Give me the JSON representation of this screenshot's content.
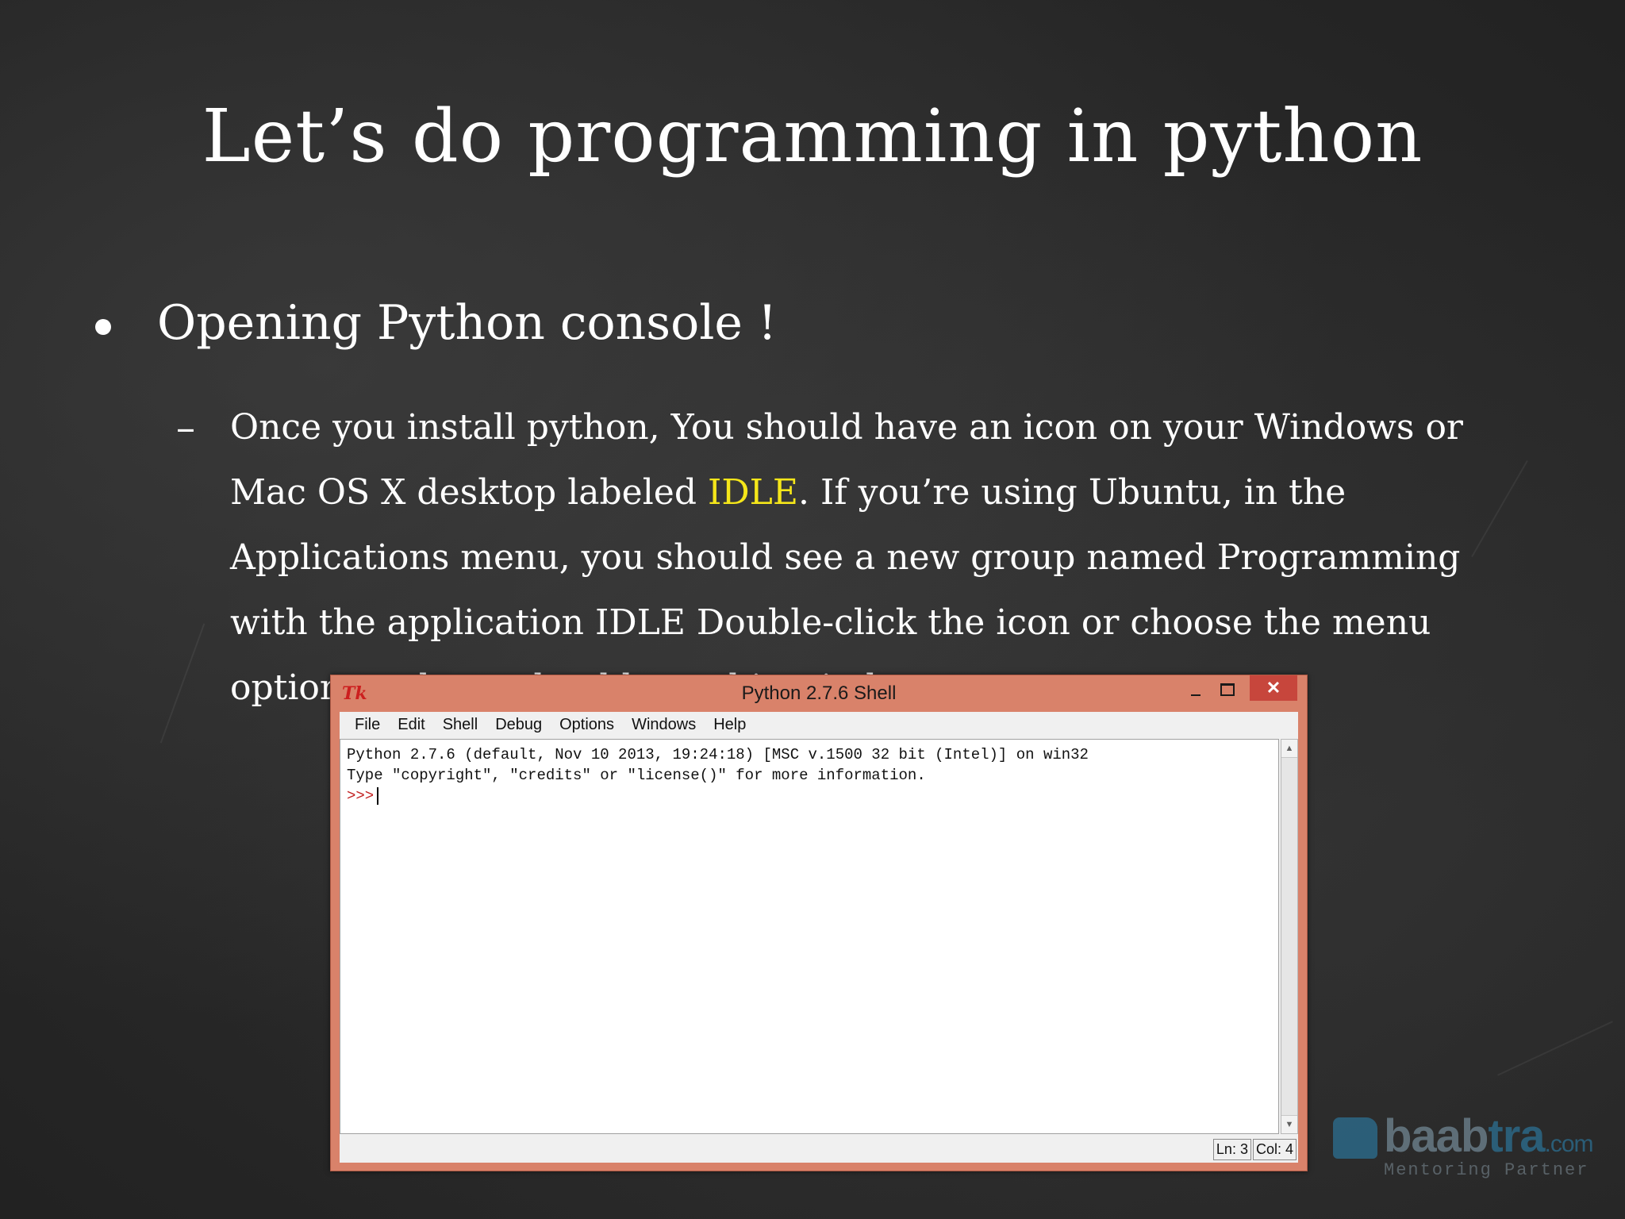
{
  "slide": {
    "title": "Let’s do programming in python",
    "bullet": "Opening Python console !",
    "sub_bullet_dash": "–",
    "sub_text_before": "Once you install python, You should have an icon on your Windows or Mac OS X desktop labeled ",
    "sub_text_highlight": "IDLE",
    "sub_text_after": ". If you’re using Ubuntu, in the Applications menu, you should see a new group named Programming with the application IDLE Double-click the icon or choose the menu option, and you should see this window:",
    "highlight_color": "#f5e61a"
  },
  "idle_window": {
    "title": "Python 2.7.6 Shell",
    "tk_icon_label": "Tk",
    "controls": {
      "minimize": "minimize-icon",
      "maximize": "maximize-icon",
      "close_label": "✕"
    },
    "menu": [
      "File",
      "Edit",
      "Shell",
      "Debug",
      "Options",
      "Windows",
      "Help"
    ],
    "console_lines": [
      "Python 2.7.6 (default, Nov 10 2013, 19:24:18) [MSC v.1500 32 bit (Intel)] on win32",
      "Type \"copyright\", \"credits\" or \"license()\" for more information."
    ],
    "prompt": ">>>",
    "status": {
      "line": "Ln: 3",
      "col": "Col: 4"
    },
    "frame_color": "#d9826a"
  },
  "logo": {
    "name_part1": "baab",
    "name_part2": "tra",
    "domain": ".com",
    "tagline": "Mentoring Partner"
  }
}
